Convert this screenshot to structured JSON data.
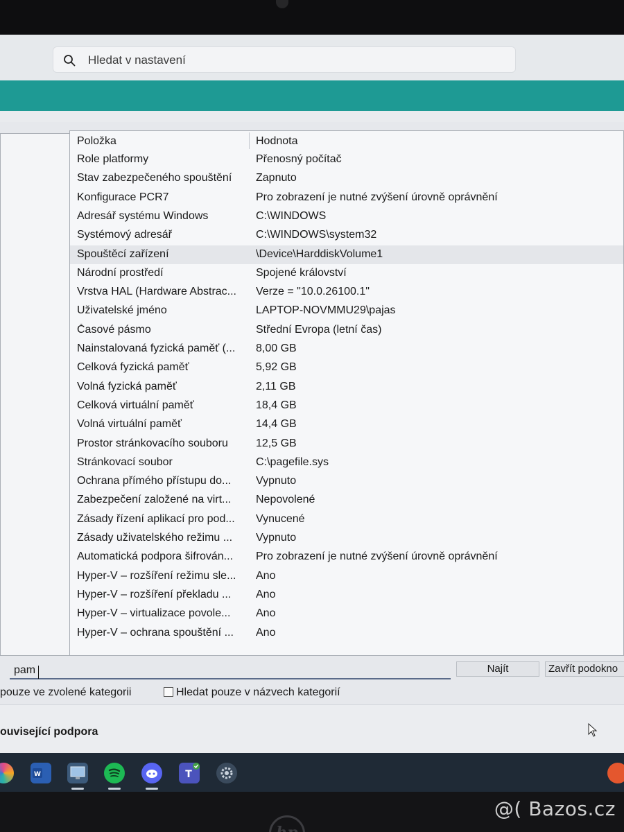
{
  "search": {
    "placeholder": "Hledat v nastavení"
  },
  "table": {
    "headers": {
      "item": "Položka",
      "value": "Hodnota"
    },
    "rows": [
      {
        "item": "Role platformy",
        "value": "Přenosný počítač"
      },
      {
        "item": "Stav zabezpečeného spouštění",
        "value": "Zapnuto"
      },
      {
        "item": "Konfigurace PCR7",
        "value": "Pro zobrazení je nutné zvýšení úrovně oprávnění"
      },
      {
        "item": "Adresář systému Windows",
        "value": "C:\\WINDOWS"
      },
      {
        "item": "Systémový adresář",
        "value": "C:\\WINDOWS\\system32"
      },
      {
        "item": "Spouštěcí zařízení",
        "value": "\\Device\\HarddiskVolume1"
      },
      {
        "item": "Národní prostředí",
        "value": "Spojené království"
      },
      {
        "item": "Vrstva HAL (Hardware Abstrac...",
        "value": "Verze = \"10.0.26100.1\""
      },
      {
        "item": "Uživatelské jméno",
        "value": "LAPTOP-NOVMMU29\\pajas"
      },
      {
        "item": "Časové pásmo",
        "value": "Střední Evropa (letní čas)"
      },
      {
        "item": "Nainstalovaná fyzická paměť (...",
        "value": "8,00 GB"
      },
      {
        "item": "Celková fyzická paměť",
        "value": "5,92 GB"
      },
      {
        "item": "Volná fyzická paměť",
        "value": "2,11 GB"
      },
      {
        "item": "Celková virtuální paměť",
        "value": "18,4 GB"
      },
      {
        "item": "Volná virtuální paměť",
        "value": "14,4 GB"
      },
      {
        "item": "Prostor stránkovacího souboru",
        "value": "12,5 GB"
      },
      {
        "item": "Stránkovací soubor",
        "value": "C:\\pagefile.sys"
      },
      {
        "item": "Ochrana přímého přístupu do...",
        "value": "Vypnuto"
      },
      {
        "item": "Zabezpečení založené na virt...",
        "value": "Nepovolené"
      },
      {
        "item": "Zásady řízení aplikací pro pod...",
        "value": "Vynucené"
      },
      {
        "item": "Zásady uživatelského režimu ...",
        "value": "Vypnuto"
      },
      {
        "item": "Automatická podpora šifrován...",
        "value": "Pro zobrazení je nutné zvýšení úrovně oprávnění"
      },
      {
        "item": "Hyper-V – rozšíření režimu sle...",
        "value": "Ano"
      },
      {
        "item": "Hyper-V – rozšíření překladu ...",
        "value": "Ano"
      },
      {
        "item": "Hyper-V – virtualizace povole...",
        "value": "Ano"
      },
      {
        "item": "Hyper-V – ochrana spouštění ...",
        "value": "Ano"
      }
    ]
  },
  "find": {
    "value": "pam",
    "find_label": "Najít",
    "close_label": "Zavřít podokno",
    "option_selected_category": "pouze ve zvolené kategorii",
    "option_category_names": "Hledat pouze v názvech kategorií"
  },
  "related": {
    "title": "ouvisející podpora"
  },
  "taskbar": {
    "icons": [
      "copilot-icon",
      "word-icon",
      "system-info-icon",
      "spotify-icon",
      "discord-icon",
      "teams-icon",
      "settings-icon"
    ]
  },
  "watermark": "@( Bazos.cz",
  "colors": {
    "banner": "#1e9a94",
    "taskbar": "#1f2a36",
    "spotify": "#1db954",
    "discord": "#5865f2"
  }
}
